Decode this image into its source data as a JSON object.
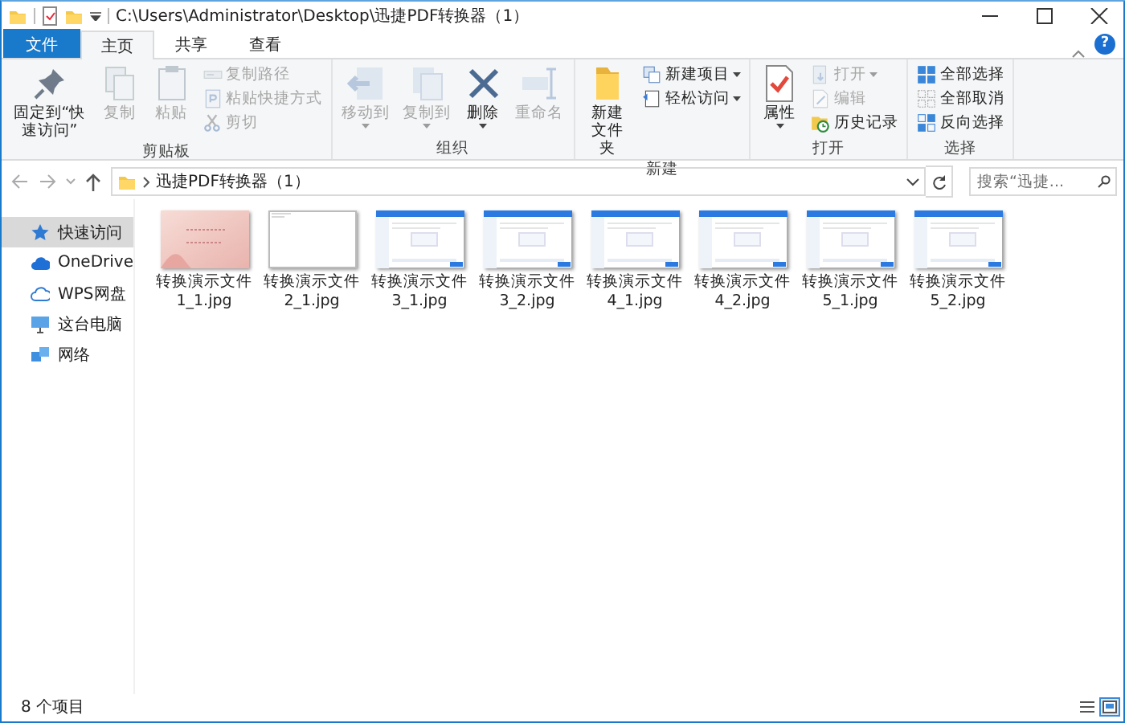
{
  "title_bar": {
    "path": "C:\\Users\\Administrator\\Desktop\\迅捷PDF转换器（1）"
  },
  "ribbon": {
    "tabs": [
      {
        "label": "文件",
        "kind": "file",
        "selected": false
      },
      {
        "label": "主页",
        "kind": "tab",
        "selected": true
      },
      {
        "label": "共享",
        "kind": "tab",
        "selected": false
      },
      {
        "label": "查看",
        "kind": "tab",
        "selected": false
      }
    ],
    "help": "?",
    "groups": [
      {
        "label": "剪贴板",
        "items": [
          {
            "label": "固定到“快速访问”",
            "kind": "large",
            "disabled": false,
            "dropdown": false
          },
          {
            "label": "复制",
            "kind": "large",
            "disabled": true,
            "dropdown": false
          },
          {
            "label": "粘贴",
            "kind": "large",
            "disabled": true,
            "dropdown": false
          },
          {
            "label": "复制路径",
            "kind": "small",
            "disabled": true,
            "dropdown": false
          },
          {
            "label": "粘贴快捷方式",
            "kind": "small",
            "disabled": true,
            "dropdown": false
          },
          {
            "label": "剪切",
            "kind": "small",
            "disabled": true,
            "dropdown": false
          }
        ]
      },
      {
        "label": "组织",
        "items": [
          {
            "label": "移动到",
            "kind": "large",
            "disabled": true,
            "dropdown": true
          },
          {
            "label": "复制到",
            "kind": "large",
            "disabled": true,
            "dropdown": true
          },
          {
            "label": "删除",
            "kind": "large",
            "disabled": false,
            "dropdown": true
          },
          {
            "label": "重命名",
            "kind": "large",
            "disabled": true,
            "dropdown": false
          }
        ]
      },
      {
        "label": "新建",
        "items": [
          {
            "label": "新建文件夹",
            "kind": "large",
            "disabled": false,
            "dropdown": false
          },
          {
            "label": "新建项目",
            "kind": "small",
            "disabled": false,
            "dropdown": true
          },
          {
            "label": "轻松访问",
            "kind": "small",
            "disabled": false,
            "dropdown": true
          }
        ]
      },
      {
        "label": "打开",
        "items": [
          {
            "label": "属性",
            "kind": "large",
            "disabled": false,
            "dropdown": true
          },
          {
            "label": "打开",
            "kind": "small",
            "disabled": true,
            "dropdown": true
          },
          {
            "label": "编辑",
            "kind": "small",
            "disabled": true,
            "dropdown": false
          },
          {
            "label": "历史记录",
            "kind": "small",
            "disabled": false,
            "dropdown": false
          }
        ]
      },
      {
        "label": "选择",
        "items": [
          {
            "label": "全部选择",
            "kind": "small",
            "disabled": false,
            "dropdown": false
          },
          {
            "label": "全部取消",
            "kind": "small",
            "disabled": false,
            "dropdown": false
          },
          {
            "label": "反向选择",
            "kind": "small",
            "disabled": false,
            "dropdown": false
          }
        ]
      }
    ]
  },
  "address_bar": {
    "breadcrumb": "迅捷PDF转换器（1）",
    "search": {
      "placeholder": "搜索“迅捷..."
    }
  },
  "nav_pane": {
    "items": [
      {
        "label": "快速访问",
        "selected": true
      },
      {
        "label": "OneDrive",
        "selected": false
      },
      {
        "label": "WPS网盘",
        "selected": false
      },
      {
        "label": "这台电脑",
        "selected": false
      },
      {
        "label": "网络",
        "selected": false
      }
    ]
  },
  "files": [
    {
      "name": "转换演示文件1_1.jpg",
      "kind": "slide",
      "selected": false
    },
    {
      "name": "转换演示文件2_1.jpg",
      "kind": "blank",
      "selected": false
    },
    {
      "name": "转换演示文件3_1.jpg",
      "kind": "screen",
      "selected": false
    },
    {
      "name": "转换演示文件3_2.jpg",
      "kind": "screen",
      "selected": false
    },
    {
      "name": "转换演示文件4_1.jpg",
      "kind": "screen",
      "selected": false
    },
    {
      "name": "转换演示文件4_2.jpg",
      "kind": "screen",
      "selected": false
    },
    {
      "name": "转换演示文件5_1.jpg",
      "kind": "screen",
      "selected": false
    },
    {
      "name": "转换演示文件5_2.jpg",
      "kind": "screen",
      "selected": false
    }
  ],
  "status_bar": {
    "text": "8 个项目",
    "view_buttons": [
      {
        "selected": false
      },
      {
        "selected": true
      }
    ]
  }
}
